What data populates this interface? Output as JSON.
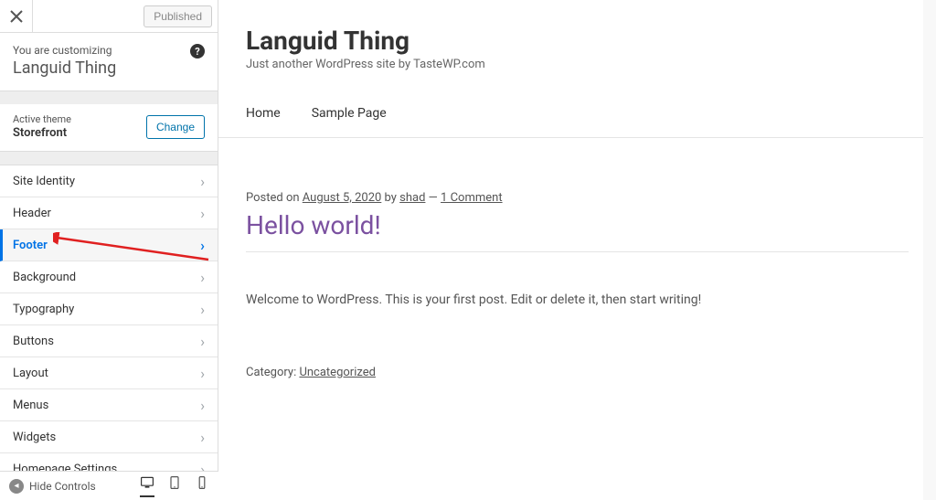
{
  "topbar": {
    "published_label": "Published"
  },
  "customizing": {
    "label": "You are customizing",
    "site": "Languid Thing"
  },
  "theme": {
    "label": "Active theme",
    "name": "Storefront",
    "change_label": "Change"
  },
  "menu": [
    {
      "label": "Site Identity",
      "active": false
    },
    {
      "label": "Header",
      "active": false
    },
    {
      "label": "Footer",
      "active": true
    },
    {
      "label": "Background",
      "active": false
    },
    {
      "label": "Typography",
      "active": false
    },
    {
      "label": "Buttons",
      "active": false
    },
    {
      "label": "Layout",
      "active": false
    },
    {
      "label": "Menus",
      "active": false
    },
    {
      "label": "Widgets",
      "active": false
    },
    {
      "label": "Homepage Settings",
      "active": false
    }
  ],
  "footer_bar": {
    "hide_label": "Hide Controls"
  },
  "preview": {
    "site_title": "Languid Thing",
    "site_tagline": "Just another WordPress site by TasteWP.com",
    "nav": [
      "Home",
      "Sample Page"
    ],
    "post": {
      "posted_on": "Posted on ",
      "date": "August 5, 2020",
      "by": " by ",
      "author": "shad",
      "dash": " — ",
      "comments": "1 Comment",
      "title": "Hello world!",
      "body": "Welcome to WordPress. This is your first post. Edit or delete it, then start writing!",
      "category_label": "Category: ",
      "category": "Uncategorized"
    }
  }
}
